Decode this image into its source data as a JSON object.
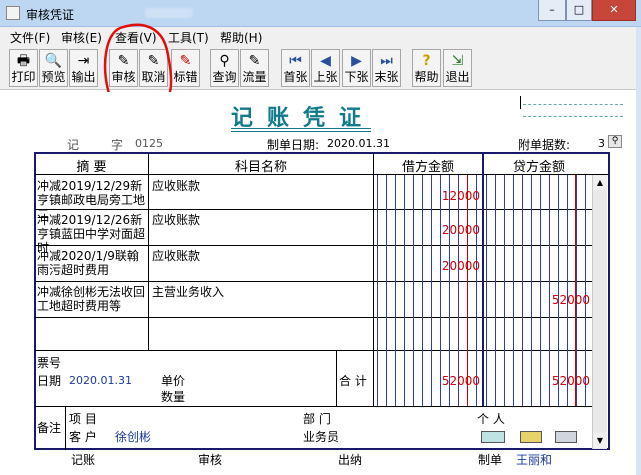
{
  "window": {
    "title": "审核凭证",
    "min": "–",
    "max": "□",
    "close": "✕"
  },
  "menu": [
    {
      "label": "文件(F)"
    },
    {
      "label": "审核(E)"
    },
    {
      "label": "查看(V)"
    },
    {
      "label": "工具(T)"
    },
    {
      "label": "帮助(H)"
    }
  ],
  "toolbar": [
    {
      "label": "打印",
      "icon": "printer-icon",
      "glyph": "🖶"
    },
    {
      "label": "预览",
      "icon": "preview-icon",
      "glyph": "🔍"
    },
    {
      "label": "输出",
      "icon": "export-icon",
      "glyph": "⇥"
    },
    {
      "label": "审核",
      "icon": "audit-icon",
      "glyph": "✎"
    },
    {
      "label": "取消",
      "icon": "cancel-icon",
      "glyph": "✎"
    },
    {
      "label": "标错",
      "icon": "mark-error-icon",
      "glyph": "✎"
    },
    {
      "label": "查询",
      "icon": "query-icon",
      "glyph": "⚲"
    },
    {
      "label": "流量",
      "icon": "flow-icon",
      "glyph": "✎"
    },
    {
      "label": "首张",
      "icon": "first-icon",
      "glyph": "⏮"
    },
    {
      "label": "上张",
      "icon": "prev-icon",
      "glyph": "◀"
    },
    {
      "label": "下张",
      "icon": "next-icon",
      "glyph": "▶"
    },
    {
      "label": "末张",
      "icon": "last-icon",
      "glyph": "⏭"
    },
    {
      "label": "帮助",
      "icon": "help-icon",
      "glyph": "?"
    },
    {
      "label": "退出",
      "icon": "exit-icon",
      "glyph": "⇲"
    }
  ],
  "voucher": {
    "title": "记账凭证",
    "type_label": "记",
    "word_label": "字",
    "number": "0125",
    "date_label": "制单日期:",
    "date": "2020.01.31",
    "attachments_label": "附单据数:",
    "attachments": "3",
    "headers": {
      "summary": "摘 要",
      "account": "科目名称",
      "debit": "借方金额",
      "credit": "贷方金额"
    },
    "rows": [
      {
        "summary": "冲减2019/12/29新亨镇邮政电局旁工地二",
        "account": "应收账款",
        "debit": "12000",
        "credit": ""
      },
      {
        "summary": "冲减2019/12/26新亨镇蓝田中学对面超时",
        "account": "应收账款",
        "debit": "20000",
        "credit": ""
      },
      {
        "summary": "冲减2020/1/9联翰雨污超时费用",
        "account": "应收账款",
        "debit": "20000",
        "credit": ""
      },
      {
        "summary": "冲减徐创彬无法收回工地超时费用等",
        "account": "主营业务收入",
        "debit": "",
        "credit": "52000"
      },
      {
        "summary": "",
        "account": "",
        "debit": "",
        "credit": ""
      }
    ],
    "footer": {
      "ticket_no_label": "票号",
      "date_label": "日期",
      "date": "2020.01.31",
      "unit_price_label": "单价",
      "quantity_label": "数量",
      "total_label": "合 计",
      "total_debit": "52000",
      "total_credit": "52000"
    },
    "memo": {
      "label": "备注",
      "project_label": "项 目",
      "dept_label": "部 门",
      "person_label": "个 人",
      "customer_label": "客 户",
      "customer": "徐创彬",
      "salesperson_label": "业务员"
    },
    "signatures": {
      "bookkeeper": "记账",
      "auditor": "审核",
      "cashier": "出纳",
      "maker": "制单",
      "maker_name": "王丽和"
    }
  },
  "colors": {
    "annotation_circle": "#e01010",
    "title_teal": "#117a8b",
    "blue": "#1a3a9e",
    "red": "#d00000"
  }
}
